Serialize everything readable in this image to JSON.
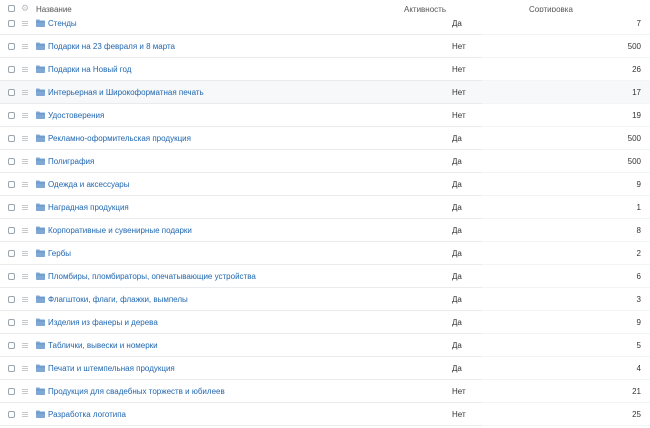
{
  "header": {
    "name_label": "Название",
    "active_label": "Активность",
    "sort_label": "Сортировка"
  },
  "rows": [
    {
      "name": "Стенды",
      "active": "Да",
      "sort": "7"
    },
    {
      "name": "Подарки на 23 февраля и 8 марта",
      "active": "Нет",
      "sort": "500"
    },
    {
      "name": "Подарки на Новый год",
      "active": "Нет",
      "sort": "26"
    },
    {
      "name": "Интерьерная и Широкоформатная печать",
      "active": "Нет",
      "sort": "17"
    },
    {
      "name": "Удостоверения",
      "active": "Нет",
      "sort": "19"
    },
    {
      "name": "Рекламно-оформительская продукция",
      "active": "Да",
      "sort": "500"
    },
    {
      "name": "Полиграфия",
      "active": "Да",
      "sort": "500"
    },
    {
      "name": "Одежда и аксессуары",
      "active": "Да",
      "sort": "9"
    },
    {
      "name": "Наградная продукция",
      "active": "Да",
      "sort": "1"
    },
    {
      "name": "Корпоративные и сувенирные подарки",
      "active": "Да",
      "sort": "8"
    },
    {
      "name": "Гербы",
      "active": "Да",
      "sort": "2"
    },
    {
      "name": "Пломбиры, пломбираторы, опечатывающие устройства",
      "active": "Да",
      "sort": "6"
    },
    {
      "name": "Флагштоки, флаги, флажки, вымпелы",
      "active": "Да",
      "sort": "3"
    },
    {
      "name": "Изделия из фанеры и дерева",
      "active": "Да",
      "sort": "9"
    },
    {
      "name": "Таблички, вывески и номерки",
      "active": "Да",
      "sort": "5"
    },
    {
      "name": "Печати и штемпельная продукция",
      "active": "Да",
      "sort": "4"
    },
    {
      "name": "Продукция для свадебных торжеств и юбилеев",
      "active": "Нет",
      "sort": "21"
    },
    {
      "name": "Разработка логотипа",
      "active": "Нет",
      "sort": "25"
    }
  ],
  "colors": {
    "link": "#2067b0",
    "folder": "#7fa8d4",
    "folder_dark": "#5d8cc0",
    "highlight_row": "#f7f8f9"
  },
  "icons": {
    "settings": "gear-icon",
    "row_menu": "menu-icon",
    "section": "folder-icon"
  }
}
